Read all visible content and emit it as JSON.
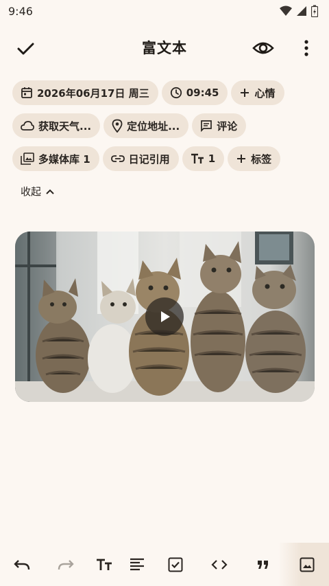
{
  "status_bar": {
    "time": "9:46"
  },
  "app_bar": {
    "title": "富文本"
  },
  "chips": {
    "date": "2026年06月17日 周三",
    "time": "09:45",
    "mood": "心情",
    "weather": "获取天气...",
    "location": "定位地址...",
    "comment": "评论",
    "media_library": "多媒体库 1",
    "diary_ref": "日记引用",
    "text_style": "1",
    "tags": "标签"
  },
  "collapse": {
    "label": "收起"
  },
  "media": {
    "type": "video",
    "description_icon": "play-icon"
  },
  "toolbar": {
    "icons": [
      "undo-icon",
      "redo-icon",
      "text-size-icon",
      "align-icon",
      "checkbox-icon",
      "code-icon",
      "quote-icon",
      "image-icon"
    ]
  },
  "colors": {
    "background": "#fcf7f2",
    "chip": "#efe4d8",
    "text": "#1f1b17"
  }
}
